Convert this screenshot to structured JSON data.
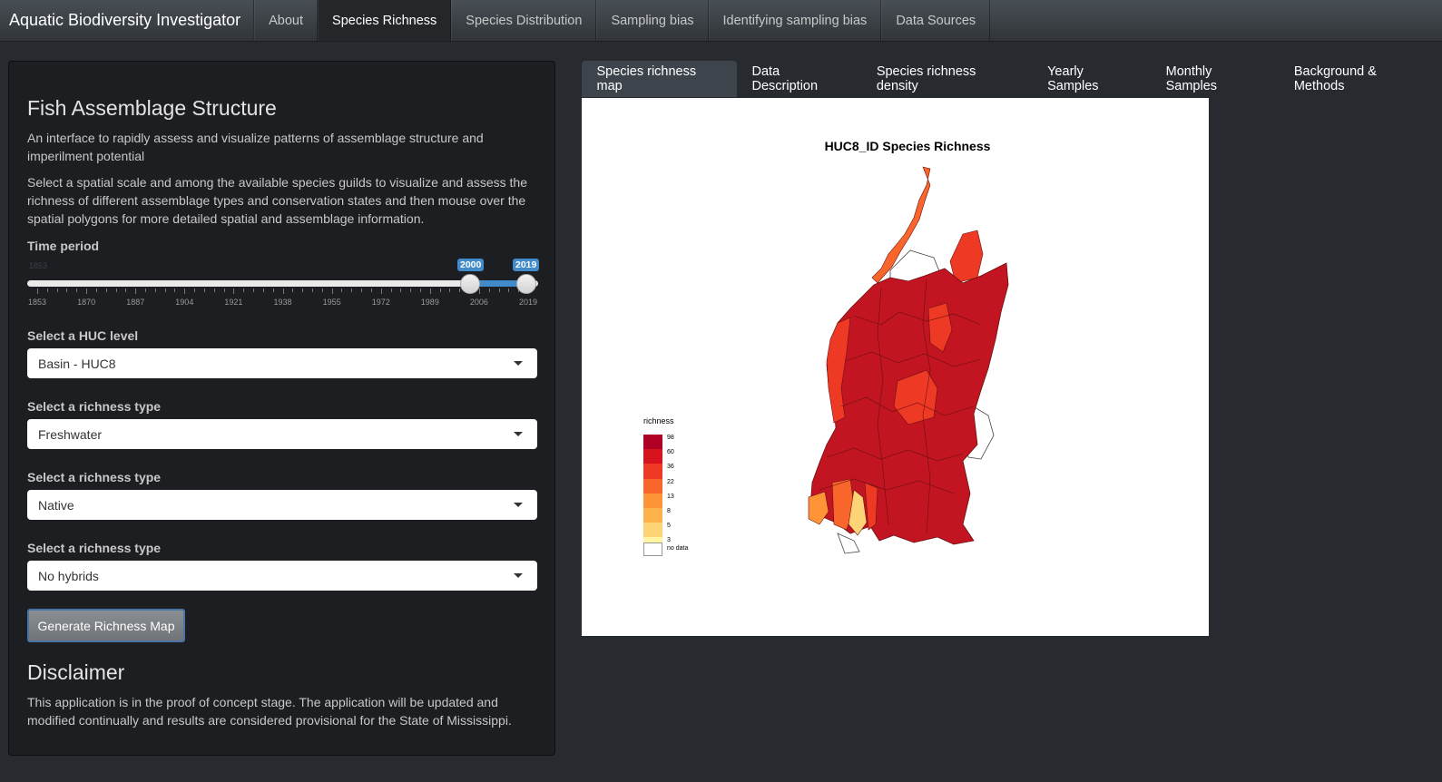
{
  "navbar": {
    "brand": "Aquatic Biodiversity Investigator",
    "items": [
      "About",
      "Species Richness",
      "Species Distribution",
      "Sampling bias",
      "Identifying sampling bias",
      "Data Sources"
    ],
    "active_index": 1
  },
  "sidebar": {
    "title": "Fish Assemblage Structure",
    "intro": "An interface to rapidly assess and visualize patterns of assemblage structure and imperilment potential",
    "instructions": "Select a spatial scale and among the available species guilds to visualize and assess the richness of different assemblage types and conservation states and then mouse over the spatial polygons for more detailed spatial and assemblage information.",
    "time_period": {
      "label": "Time period",
      "min_label": "1853",
      "from": "2000",
      "to": "2019",
      "range": [
        1853,
        2019
      ],
      "selected": [
        2000,
        2019
      ],
      "grid": [
        "1853",
        "1870",
        "1887",
        "1904",
        "1921",
        "1938",
        "1955",
        "1972",
        "1989",
        "2006",
        "2019"
      ]
    },
    "huc": {
      "label": "Select a HUC level",
      "value": "Basin - HUC8"
    },
    "richness1": {
      "label": "Select a richness type",
      "value": "Freshwater"
    },
    "richness2": {
      "label": "Select a richness type",
      "value": "Native"
    },
    "richness3": {
      "label": "Select a richness type",
      "value": "No hybrids"
    },
    "button": "Generate Richness Map",
    "disclaimer_title": "Disclaimer",
    "disclaimer": "This application is in the proof of concept stage. The application will be updated and modified continually and results are considered provisional for the State of Mississippi."
  },
  "tabs": {
    "items": [
      "Species richness map",
      "Data Description",
      "Species richness density",
      "Yearly Samples",
      "Monthly Samples",
      "Background & Methods"
    ],
    "active_index": 0
  },
  "map": {
    "title": "HUC8_ID Species Richness",
    "legend_title": "richness",
    "legend": [
      {
        "label": "98",
        "color": "#b10026"
      },
      {
        "label": "60",
        "color": "#d7131e"
      },
      {
        "label": "36",
        "color": "#ee3a24"
      },
      {
        "label": "22",
        "color": "#f9662c"
      },
      {
        "label": "13",
        "color": "#fd9438"
      },
      {
        "label": "8",
        "color": "#feb24c"
      },
      {
        "label": "5",
        "color": "#fed476"
      },
      {
        "label": "3",
        "color": "#fff5a3"
      },
      {
        "label": "no data",
        "color": "#ffffff"
      }
    ]
  }
}
